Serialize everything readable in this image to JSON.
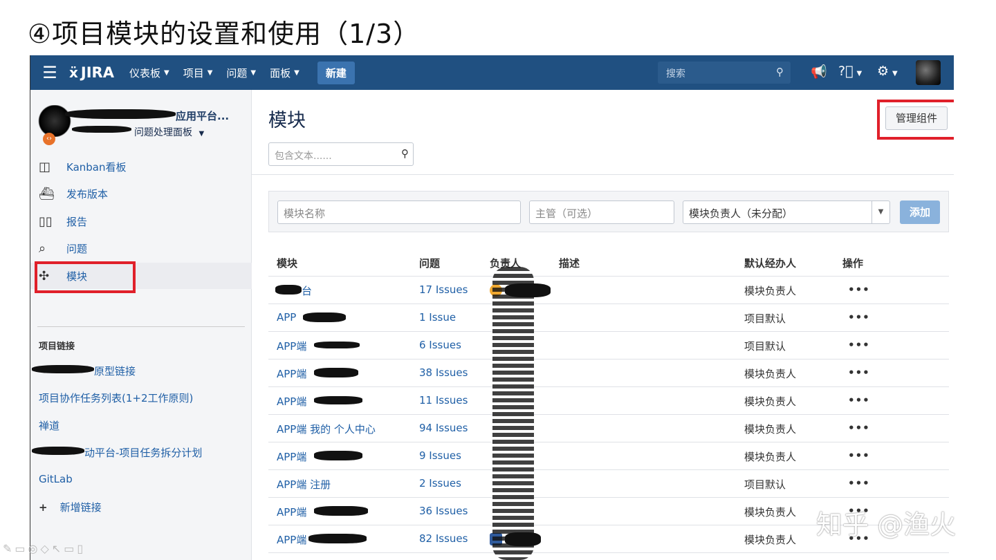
{
  "slide": {
    "title": "④项目模块的设置和使用（1/3）",
    "watermark": "知乎 @渔火",
    "toolbar_icons": "✎▭◎◇↖▭▯"
  },
  "nav": {
    "logo": "JIRA",
    "menus": [
      "仪表板",
      "项目",
      "问题",
      "面板"
    ],
    "create": "新建",
    "search_placeholder": "搜索",
    "icons": [
      "hamburger-icon",
      "megaphone-icon",
      "help-icon",
      "gear-icon"
    ]
  },
  "sidebar": {
    "project_name": "应用平台...",
    "project_sub": "问题处理面板",
    "items": [
      {
        "label": "Kanban看板",
        "icon": "board-icon"
      },
      {
        "label": "发布版本",
        "icon": "ship-icon"
      },
      {
        "label": "报告",
        "icon": "chart-icon"
      },
      {
        "label": "问题",
        "icon": "issues-icon"
      },
      {
        "label": "模块",
        "icon": "puzzle-icon"
      }
    ],
    "links_heading": "项目链接",
    "links": [
      "原型链接",
      "项目协作任务列表(1+2工作原则)",
      "禅道",
      "动平台-项目任务拆分计划",
      "GitLab"
    ],
    "add_link": "新增链接"
  },
  "main": {
    "title": "模块",
    "filter_placeholder": "包含文本......",
    "manage_button": "管理组件",
    "form": {
      "name_placeholder": "模块名称",
      "lead_placeholder": "主管（可选）",
      "assignee_value": "模块负责人（未分配）",
      "add_button": "添加"
    },
    "columns": [
      "模块",
      "问题",
      "负责人",
      "描述",
      "默认经办人",
      "操作"
    ],
    "rows": [
      {
        "name": "台",
        "issues": "17 Issues",
        "assignee": "模块负责人",
        "ops": "•••"
      },
      {
        "name": "APP",
        "issues": "1 Issue",
        "assignee": "项目默认",
        "ops": "•••"
      },
      {
        "name": "APP端",
        "issues": "6 Issues",
        "assignee": "项目默认",
        "ops": "•••"
      },
      {
        "name": "APP端",
        "issues": "38 Issues",
        "assignee": "模块负责人",
        "ops": "•••"
      },
      {
        "name": "APP端",
        "issues": "11 Issues",
        "assignee": "模块负责人",
        "ops": "•••"
      },
      {
        "name": "APP端 我的 个人中心",
        "issues": "94 Issues",
        "assignee": "模块负责人",
        "ops": "•••"
      },
      {
        "name": "APP端",
        "issues": "9 Issues",
        "assignee": "模块负责人",
        "ops": "•••"
      },
      {
        "name": "APP端 注册",
        "issues": "2 Issues",
        "assignee": "项目默认",
        "ops": "•••"
      },
      {
        "name": "APP端",
        "issues": "36 Issues",
        "assignee": "模块负责人",
        "ops": "•••"
      },
      {
        "name": "APP端",
        "issues": "82 Issues",
        "assignee": "模块负责人",
        "ops": "•••"
      }
    ]
  },
  "colors": {
    "nav_bg": "#205081",
    "link": "#1f5fa6",
    "highlight": "#e0202a",
    "add_button": "#8ab2dc"
  }
}
